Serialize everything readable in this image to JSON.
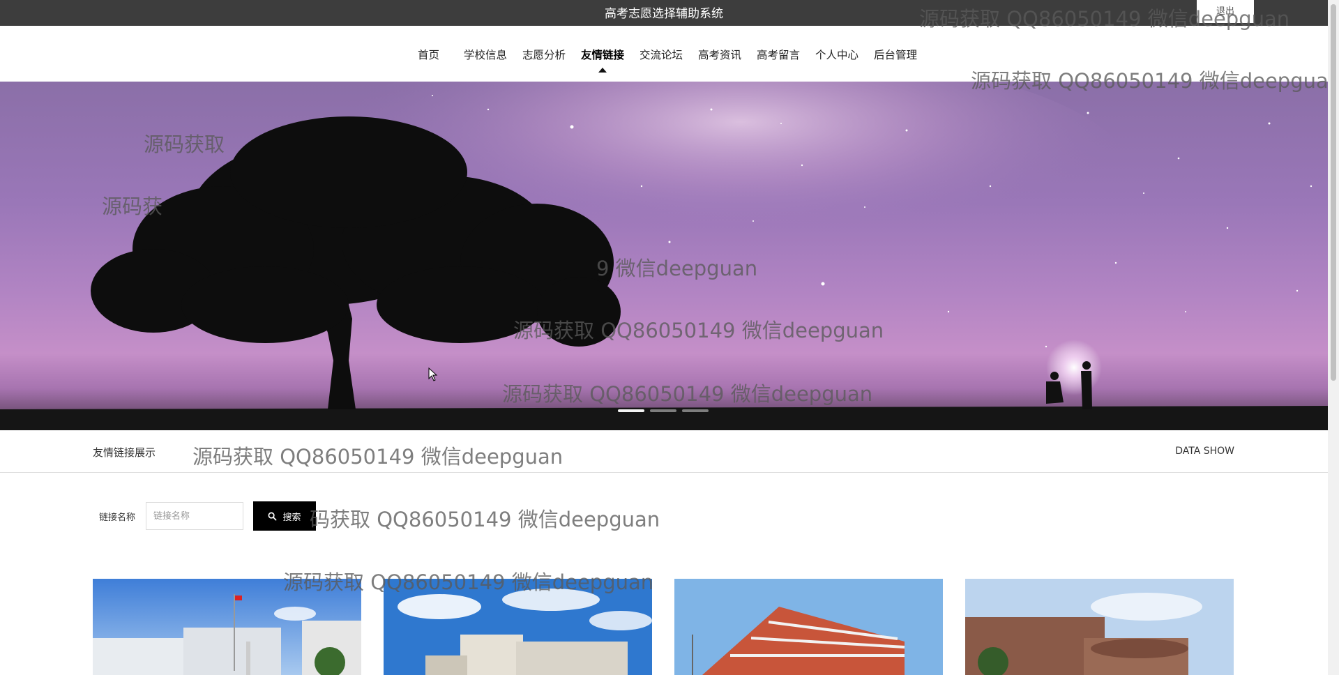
{
  "header": {
    "title": "高考志愿选择辅助系统",
    "logout_label": "退出"
  },
  "nav": {
    "items": [
      {
        "label": "首页"
      },
      {
        "label": "学校信息"
      },
      {
        "label": "志愿分析"
      },
      {
        "label": "友情链接"
      },
      {
        "label": "交流论坛"
      },
      {
        "label": "高考资讯"
      },
      {
        "label": "高考留言"
      },
      {
        "label": "个人中心"
      },
      {
        "label": "后台管理"
      }
    ],
    "active_index": 3
  },
  "banner": {
    "slide_count": 3,
    "active_slide": 0
  },
  "section": {
    "title": "友情链接展示",
    "subtitle": "DATA SHOW"
  },
  "search": {
    "label": "链接名称",
    "placeholder": "链接名称",
    "value": "",
    "button_label": "搜索"
  },
  "watermark": {
    "text": "源码获取 QQ86050149 微信deepguan",
    "partial_1": "源码获取",
    "partial_2": "源码获",
    "partial_3": "9 微信deepguan",
    "partial_4": "码获取 QQ86050149 微信deepguan"
  },
  "colors": {
    "topbar": "#3d3d3d",
    "search_button": "#000000"
  }
}
